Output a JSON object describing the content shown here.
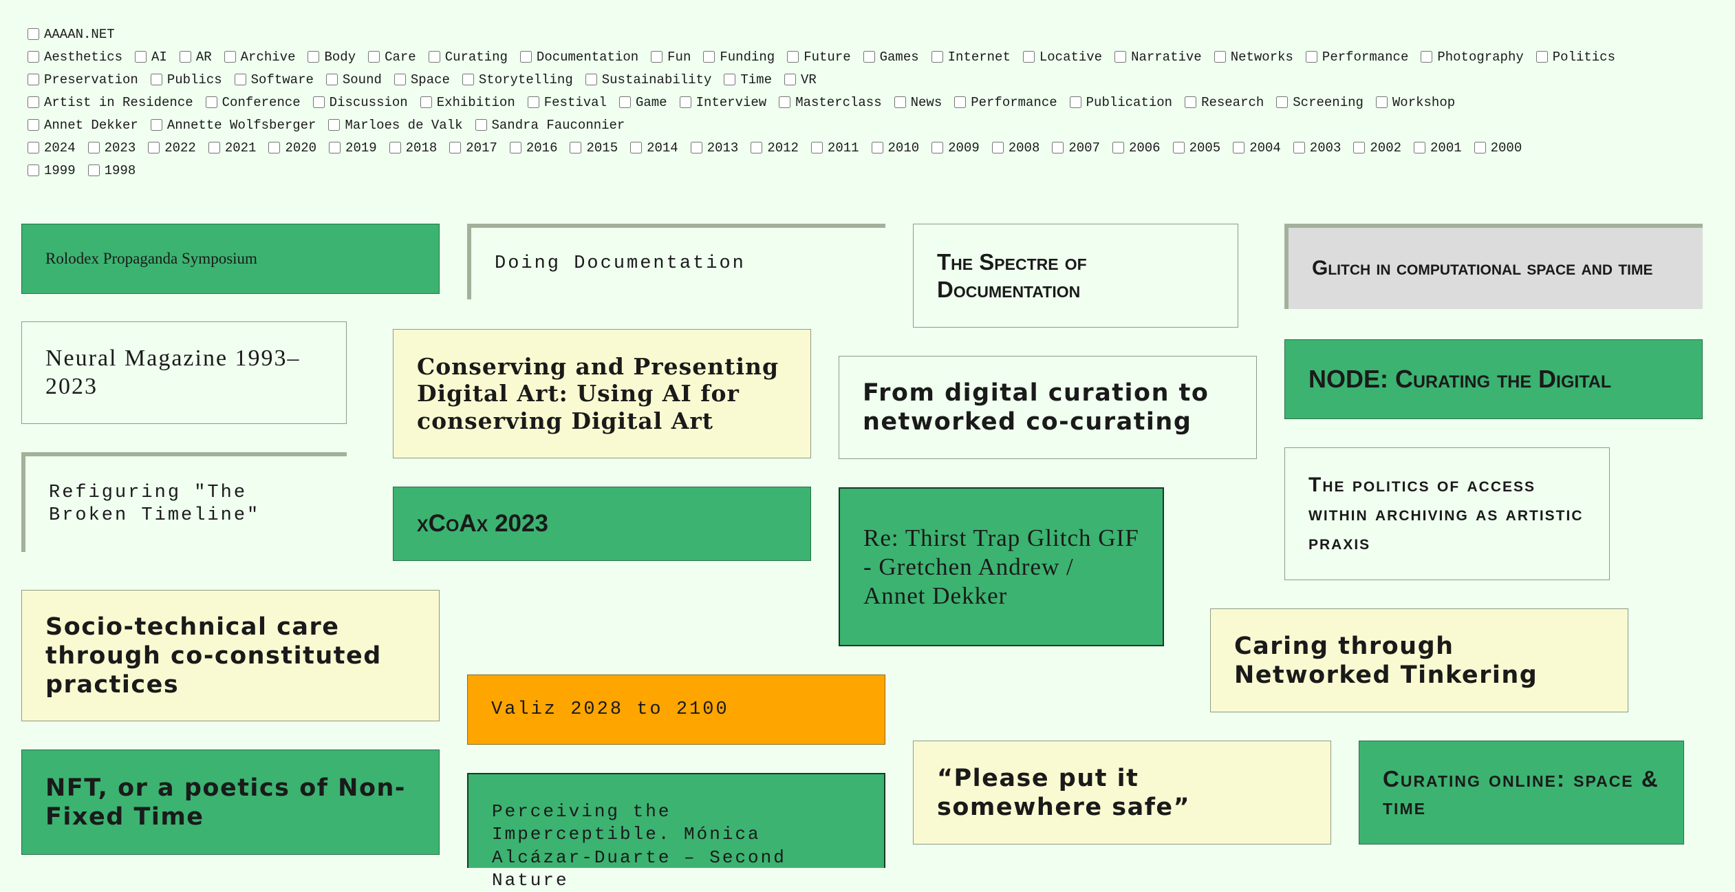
{
  "filters": {
    "site": [
      "AAAAN.NET"
    ],
    "themes": [
      "Aesthetics",
      "AI",
      "AR",
      "Archive",
      "Body",
      "Care",
      "Curating",
      "Documentation",
      "Fun",
      "Funding",
      "Future",
      "Games",
      "Internet",
      "Locative",
      "Narrative",
      "Networks",
      "Performance",
      "Photography",
      "Politics",
      "Preservation",
      "Publics",
      "Software",
      "Sound",
      "Space",
      "Storytelling",
      "Sustainability",
      "Time",
      "VR"
    ],
    "types": [
      "Artist in Residence",
      "Conference",
      "Discussion",
      "Exhibition",
      "Festival",
      "Game",
      "Interview",
      "Masterclass",
      "News",
      "Performance",
      "Publication",
      "Research",
      "Screening",
      "Workshop"
    ],
    "people": [
      "Annet Dekker",
      "Annette Wolfsberger",
      "Marloes de Valk",
      "Sandra Fauconnier"
    ],
    "years": [
      "2024",
      "2023",
      "2022",
      "2021",
      "2020",
      "2019",
      "2018",
      "2017",
      "2016",
      "2015",
      "2014",
      "2013",
      "2012",
      "2011",
      "2010",
      "2009",
      "2008",
      "2007",
      "2006",
      "2005",
      "2004",
      "2003",
      "2002",
      "2001",
      "2000",
      "1999",
      "1998"
    ]
  },
  "cards": [
    {
      "id": "rolodex",
      "title": "Rolodex Propaganda Symposium"
    },
    {
      "id": "doing-doc",
      "title": "Doing Documentation"
    },
    {
      "id": "spectre",
      "title": "The Spectre of Documentation"
    },
    {
      "id": "glitch",
      "title": "Glitch in computational space and time"
    },
    {
      "id": "neural",
      "title": "Neural Magazine 1993–2023"
    },
    {
      "id": "conserving",
      "title": "Conserving and Presenting Digital Art: Using AI for conserving Digital Art"
    },
    {
      "id": "digital-curation",
      "title": "From digital curation to networked co-curating"
    },
    {
      "id": "node",
      "title": "NODE: Curating the Digital"
    },
    {
      "id": "refiguring",
      "title": "Refiguring \"The Broken Timeline\""
    },
    {
      "id": "xcoax",
      "title": "xCoAx 2023"
    },
    {
      "id": "thirst",
      "title": "Re: Thirst Trap Glitch GIF - Gretchen Andrew / Annet Dekker"
    },
    {
      "id": "politics-access",
      "title": "The politics of access within archiving as artistic praxis"
    },
    {
      "id": "socio",
      "title": "Socio-technical care through co-constituted practices"
    },
    {
      "id": "caring",
      "title": "Caring through Networked Tinkering"
    },
    {
      "id": "valiz",
      "title": "Valiz 2028 to 2100"
    },
    {
      "id": "nft",
      "title": "NFT, or a poetics of Non-Fixed Time"
    },
    {
      "id": "please",
      "title": "“Please put it somewhere safe”"
    },
    {
      "id": "curating-online",
      "title": "Curating online: space & time"
    },
    {
      "id": "perceiving",
      "title": "Perceiving the Imperceptible. Mónica Alcázar-Duarte – Second Nature"
    }
  ]
}
